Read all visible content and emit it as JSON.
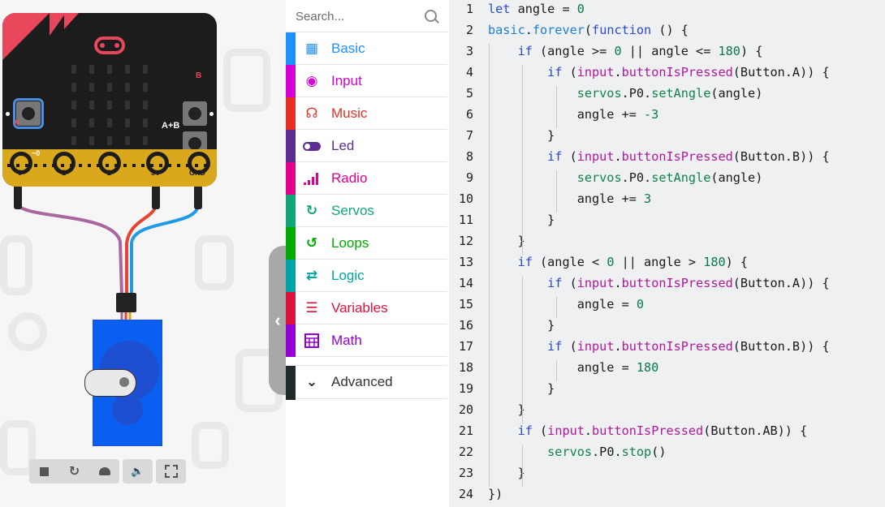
{
  "simulator": {
    "board": {
      "button_a": "A",
      "button_b": "B",
      "button_ab": "A+B",
      "pins": [
        "0",
        "1",
        "2",
        "3V",
        "GND"
      ],
      "pin0_mark": "~0"
    },
    "toolbar": {
      "buttons": [
        "stop-icon",
        "restart-icon",
        "slow-motion-icon",
        "mute-icon",
        "fullscreen-icon"
      ]
    }
  },
  "toolbox": {
    "search_placeholder": "Search...",
    "categories": [
      {
        "label": "Basic",
        "color": "#1e90ff",
        "icon": "grid-icon"
      },
      {
        "label": "Input",
        "color": "#d400d4",
        "icon": "target-icon"
      },
      {
        "label": "Music",
        "color": "#e63022",
        "icon": "headphones-icon"
      },
      {
        "label": "Led",
        "color": "#5c2d91",
        "icon": "toggle-icon"
      },
      {
        "label": "Radio",
        "color": "#e3008c",
        "icon": "signal-bars-icon"
      },
      {
        "label": "Servos",
        "color": "#13a577",
        "icon": "refresh-icon"
      },
      {
        "label": "Loops",
        "color": "#00aa00",
        "icon": "loop-arrow-icon"
      },
      {
        "label": "Logic",
        "color": "#00a4a6",
        "icon": "shuffle-icon"
      },
      {
        "label": "Variables",
        "color": "#dc143c",
        "icon": "list-icon"
      },
      {
        "label": "Math",
        "color": "#9400d3",
        "icon": "calculator-icon"
      }
    ],
    "advanced": {
      "label": "Advanced",
      "color": "#2a2a2a"
    },
    "collapse_icon": "chevron-left-icon"
  },
  "editor": {
    "line_numbers": [
      "1",
      "2",
      "3",
      "4",
      "5",
      "6",
      "7",
      "8",
      "9",
      "10",
      "11",
      "12",
      "13",
      "14",
      "15",
      "16",
      "17",
      "18",
      "19",
      "20",
      "21",
      "22",
      "23",
      "24"
    ]
  }
}
